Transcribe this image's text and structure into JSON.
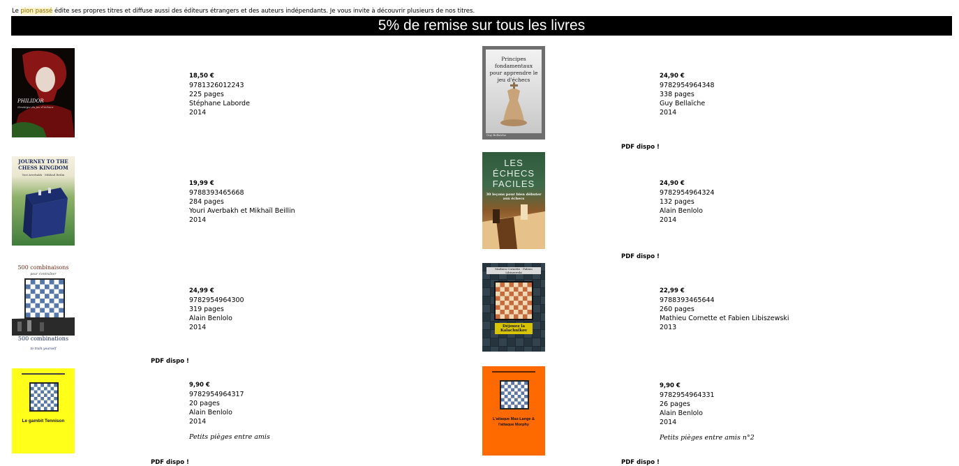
{
  "intro": {
    "before": "Le ",
    "highlight": "pion passé",
    "after": " édite ses propres titres et diffuse aussi des éditeurs étrangers et des auteurs indépendants. Je vous invite à découvrir plusieurs de nos titres."
  },
  "banner": "5% de remise sur tous les livres",
  "books": [
    {
      "price": "18,50 €",
      "isbn": "9781326012243",
      "pages": "225 pages",
      "author": "Stéphane Laborde",
      "year": "2014",
      "cover_title": "PHILIDOR",
      "cover_sub": "Stratégie du jeu d'échecs"
    },
    {
      "price": "24,90 €",
      "isbn": "9782954964348",
      "pages": "338 pages",
      "author": "Guy Bellaïche",
      "year": "2014",
      "pdf": "PDF dispo !",
      "cover_title": "Principes fondamentaux pour apprendre le jeu d'échecs",
      "cover_author": "Guy Bellaïche"
    },
    {
      "price": "19,99 €",
      "isbn": "9788393465668",
      "pages": "284 pages",
      "author": "Youri Averbakh et Mikhaïl Beillin",
      "year": "2014",
      "cover_title": "JOURNEY TO THE CHESS KINGDOM",
      "cover_author": "Yuri Averbakh · Mikhail Beilin"
    },
    {
      "price": "24,90 €",
      "isbn": "9782954964324",
      "pages": "132 pages",
      "author": "Alain Benlolo",
      "year": "2014",
      "pdf": "PDF dispo !",
      "cover_title": "LES ÉCHECS FACILES",
      "cover_sub": "30 leçons pour bien débuter aux échecs"
    },
    {
      "price": "24,99 €",
      "isbn": "9782954964300",
      "pages": "319 pages",
      "author": "Alain Benlolo",
      "year": "2014",
      "pdf": "PDF dispo !",
      "cover_title": "500 combinaisons",
      "cover_sub": "pour s'entraîner",
      "cover_title2": "500 combinations",
      "cover_sub2": "to train yourself"
    },
    {
      "price": "22,99 €",
      "isbn": "9788393465644",
      "pages": "260 pages",
      "author": "Mathieu Cornette et Fabien Libiszewski",
      "year": "2013",
      "cover_title": "Déjouez la Kalachnikov",
      "cover_author": "Mathieu Cornette · Fabien Libiszewski"
    },
    {
      "price": "9,90 €",
      "isbn": "9782954964317",
      "pages": "20 pages",
      "author": "Alain Benlolo",
      "year": "2014",
      "series": "Petits pièges entre amis",
      "pdf": "PDF dispo !",
      "cover_title": "Le gambit Tennison"
    },
    {
      "price": "9,90 €",
      "isbn": "9782954964331",
      "pages": "26 pages",
      "author": "Alain Benlolo",
      "year": "2014",
      "series": "Petits pièges entre amis n°2",
      "pdf": "PDF dispo !",
      "cover_title": "L'attaque Max-Lange & l'attaque Morphy"
    }
  ]
}
